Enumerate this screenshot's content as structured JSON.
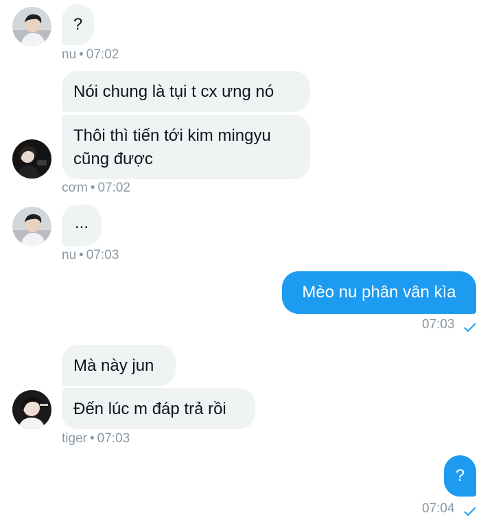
{
  "messages": {
    "m1": {
      "text": "?",
      "sender": "nu",
      "time": "07:02"
    },
    "m2a": {
      "text": "Nói chung là tụi t cx ưng nó"
    },
    "m2b": {
      "line1": "Thôi thì tiến tới kim mingyu",
      "line2": "cũng được",
      "sender": "cơm",
      "time": "07:02"
    },
    "m3": {
      "text": "...",
      "sender": "nu",
      "time": "07:03"
    },
    "m4": {
      "text": "Mèo nu phân vân kìa",
      "time": "07:03"
    },
    "m5a": {
      "text": "Mà này jun"
    },
    "m5b": {
      "text": "Đến lúc m đáp trả rồi",
      "sender": "tiger",
      "time": "07:03"
    },
    "m6": {
      "text": "?",
      "time": "07:04"
    }
  },
  "separator": "•",
  "icons": {
    "read_receipt": "check-icon"
  },
  "colors": {
    "outgoing": "#1d9bf0",
    "incoming": "#eff3f4",
    "meta": "#8b98a5"
  }
}
